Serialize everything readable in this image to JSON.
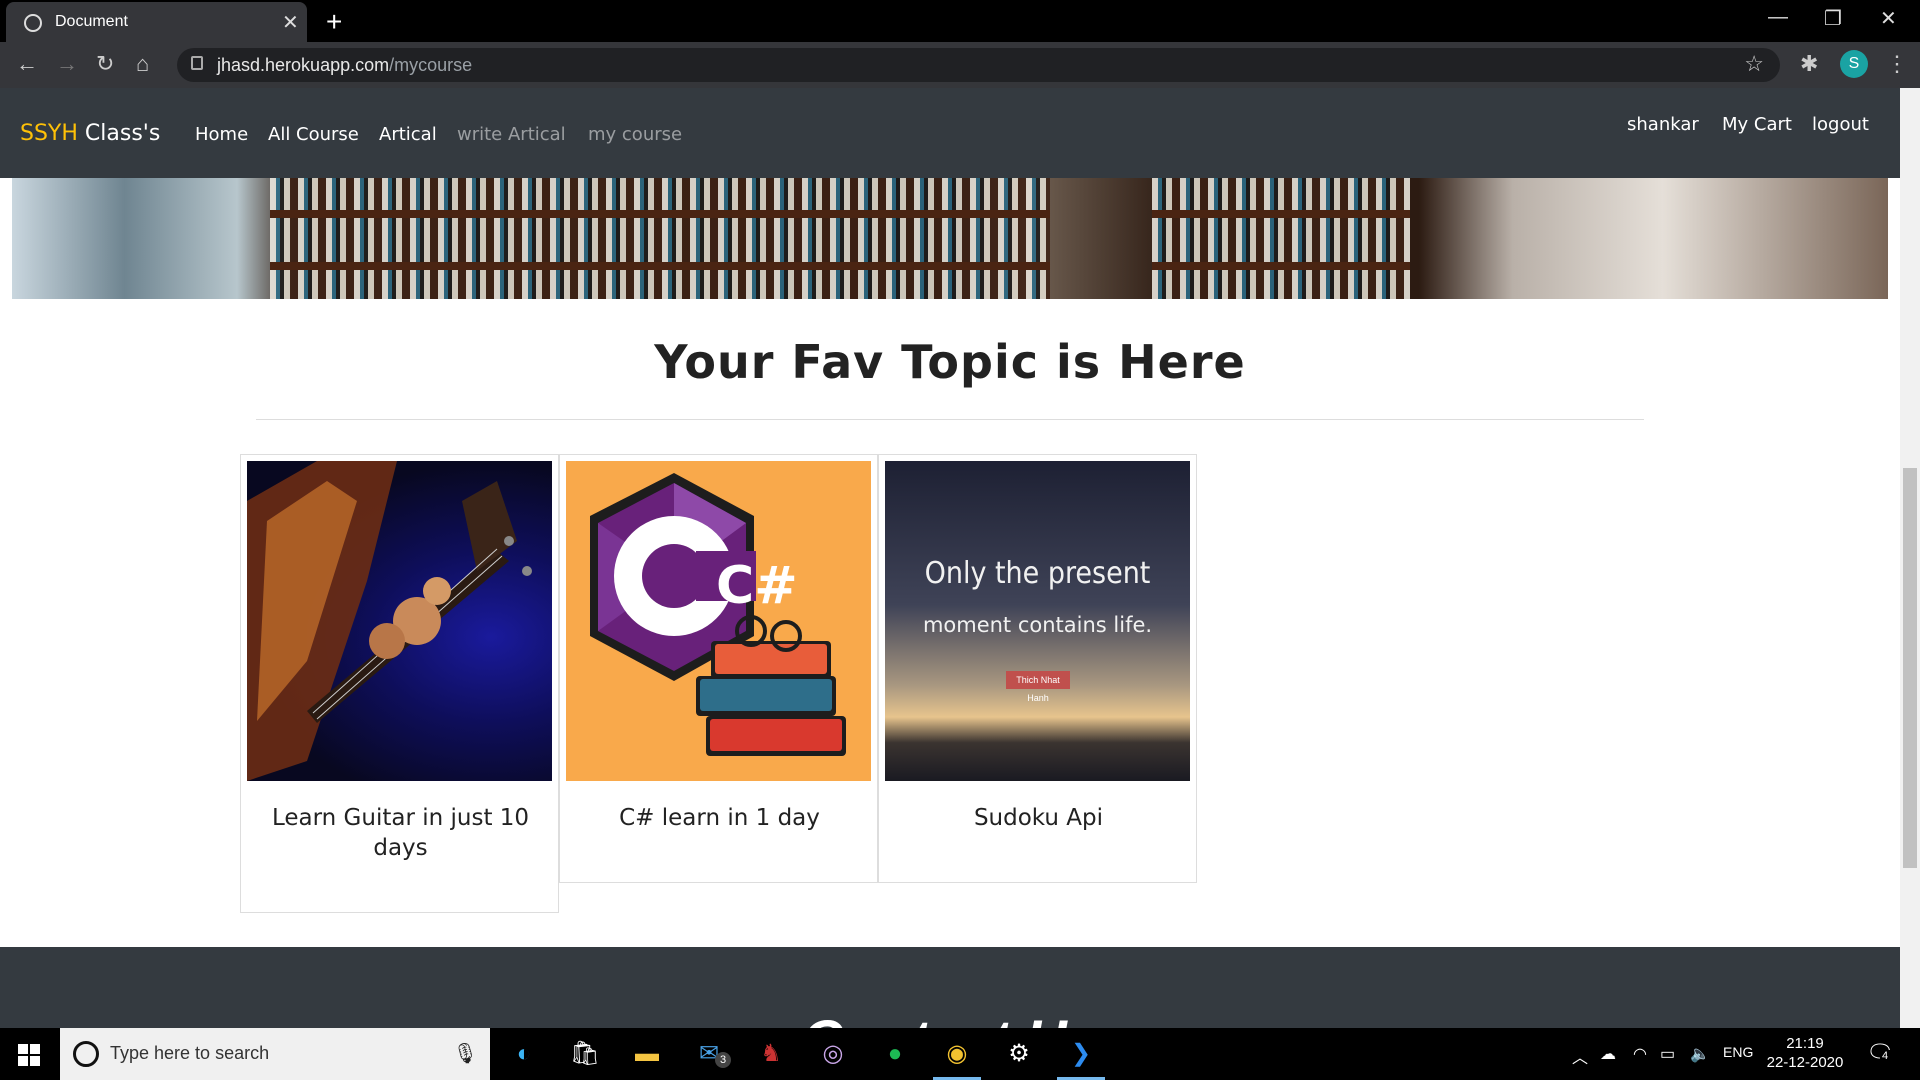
{
  "browser": {
    "tab_title": "Document",
    "new_tab_symbol": "+",
    "url_host": "jhasd.herokuapp.com",
    "url_path": "/mycourse",
    "profile_initial": "S"
  },
  "navbar": {
    "brand_accent": "SSYH",
    "brand_rest": " Class's",
    "links": [
      "Home",
      "All Course",
      "Artical",
      "write Artical",
      "my course"
    ],
    "right_links": [
      "shankar",
      "My Cart",
      "logout"
    ]
  },
  "main": {
    "heading": "Your Fav Topic is Here",
    "courses": [
      {
        "title": "Learn Guitar in just 10 days"
      },
      {
        "title": "C# learn in 1 day",
        "logo_text": "C#"
      },
      {
        "title": "Sudoku Api",
        "quote_line1": "Only the present",
        "quote_line2": "moment contains life.",
        "quote_author": "Thich Nhat Hanh"
      }
    ]
  },
  "footer": {
    "heading": "Contact Us"
  },
  "taskbar": {
    "search_placeholder": "Type here to search",
    "mail_badge": "3",
    "language": "ENG",
    "time": "21:19",
    "date": "22-12-2020",
    "notification_count": "4"
  },
  "colors": {
    "navbar_bg": "#343a40",
    "brand_accent": "#ffc107",
    "csharp_bg": "#f9a94b"
  }
}
